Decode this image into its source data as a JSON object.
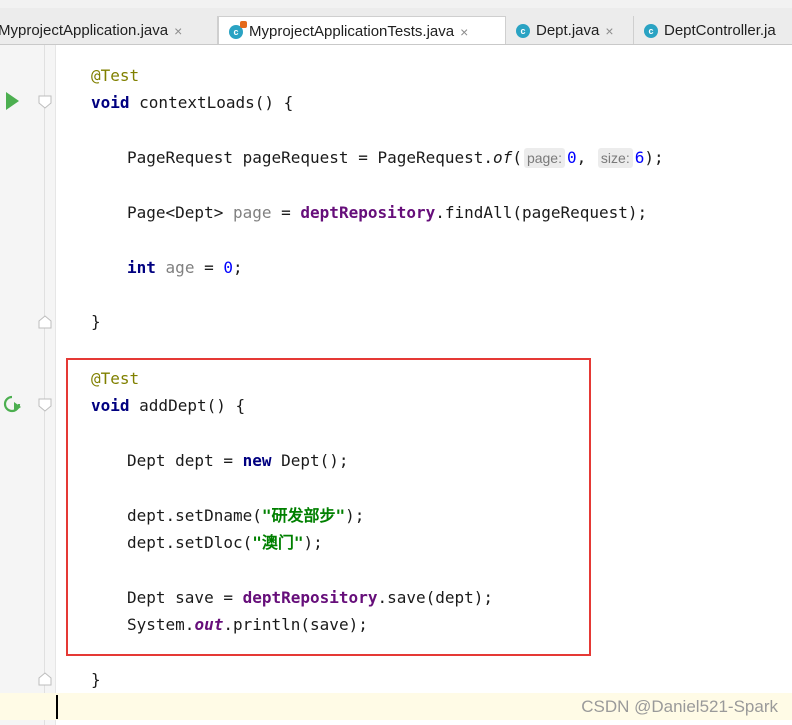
{
  "tabs": [
    {
      "label": "MyprojectApplication.java",
      "active": false
    },
    {
      "label": "MyprojectApplicationTests.java",
      "active": true
    },
    {
      "label": "Dept.java",
      "active": false
    },
    {
      "label": "DeptController.ja",
      "active": false
    }
  ],
  "close_glyph": "×",
  "code": {
    "ann1": "@Test",
    "kw_void": "void",
    "m1": " contextLoads() {",
    "l3a": "PageRequest pageRequest = PageRequest.",
    "l3b": "of",
    "l3c": "(",
    "hint_page": "page:",
    "num0": "0",
    "comma": ",",
    "hint_size": "size:",
    "num6": "6",
    "l3d": ");",
    "l4a": "Page<Dept> ",
    "l4var": "page",
    "l4b": " = ",
    "field_repo": "deptRepository",
    "l4c": ".findAll(pageRequest);",
    "kw_int": "int",
    "var_age": "age",
    "l5b": " = ",
    "l5num": "0",
    "semi": ";",
    "brace_close": "}",
    "ann2": "@Test",
    "m2": " addDept() {",
    "l8a": "Dept dept = ",
    "kw_new": "new",
    "l8b": " Dept();",
    "l9a": "dept.setDname(",
    "str1": "\"研发部步\"",
    "l9b": ");",
    "l10a": "dept.setDloc(",
    "str2": "\"澳门\"",
    "l10b": ");",
    "l11a": "Dept save = ",
    "l11b": ".save(dept);",
    "l12a": "System.",
    "static_out": "out",
    "l12b": ".println(save);"
  },
  "colors": {
    "highlight": "#e53935",
    "run": "#4caf50"
  },
  "watermark": "CSDN @Daniel521-Spark"
}
